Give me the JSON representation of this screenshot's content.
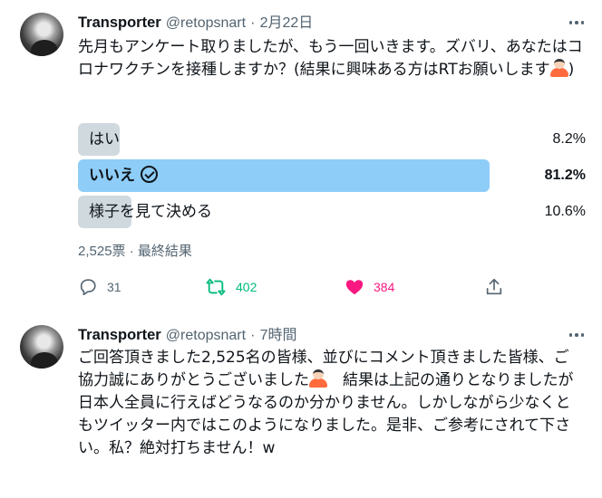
{
  "tweets": [
    {
      "author": {
        "name": "Transporter",
        "handle": "@retopsnart"
      },
      "separator": "·",
      "time": "2月22日",
      "text_before_emoji": "先月もアンケート取りましたが、もう一回いきます。ズバリ、あなたはコロナワクチンを接種しますか？(結果に興味ある方はRTお願いします",
      "text_after_emoji": ")",
      "emoji": "person-gesturing-ok-emoji",
      "poll": {
        "options": [
          {
            "label": "はい",
            "percent": "8.2%",
            "fraction": 0.082,
            "winner": false
          },
          {
            "label": "いいえ",
            "percent": "81.2%",
            "fraction": 0.812,
            "winner": true
          },
          {
            "label": "様子を見て決める",
            "percent": "10.6%",
            "fraction": 0.106,
            "winner": false
          }
        ],
        "meta": "2,525票 · 最終結果"
      },
      "actions": {
        "replies": "31",
        "retweets": "402",
        "likes": "384"
      },
      "colors": {
        "winner_bar": "#8ecdf8",
        "loser_bar": "#cfd9de",
        "retweet": "#00ba7c",
        "like": "#f91880"
      }
    },
    {
      "author": {
        "name": "Transporter",
        "handle": "@retopsnart"
      },
      "separator": "·",
      "time": "7時間",
      "text_before_emoji": "ご回答頂きました2,525名の皆様、並びにコメント頂きました皆様、ご協力誠にありがとうございました",
      "text_after_emoji": "　結果は上記の通りとなりましたが日本人全員に行えばどうなるのか分かりません。しかしながら少なくともツイッター内ではこのようになりました。是非、ご参考にされて下さい。私？絶対打ちません！w",
      "emoji": "person-gesturing-ok-emoji"
    }
  ]
}
